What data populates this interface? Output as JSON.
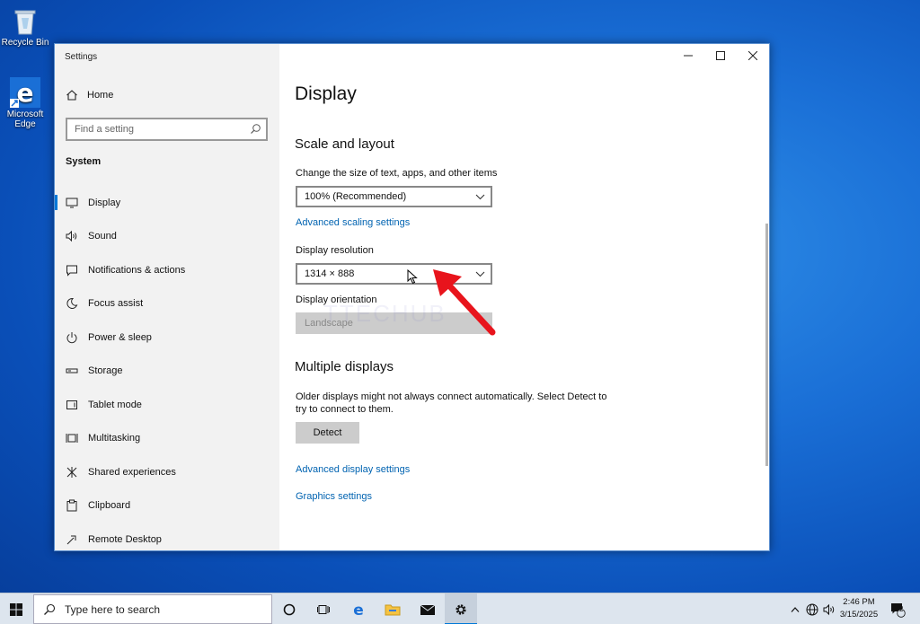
{
  "desktop": {
    "icons": [
      {
        "label": "Recycle Bin",
        "icon": "recycle-bin-icon"
      },
      {
        "label": "Microsoft Edge",
        "icon": "edge-icon"
      }
    ]
  },
  "window": {
    "title": "Settings",
    "controls": [
      "minimize-icon",
      "maximize-icon",
      "close-icon"
    ]
  },
  "sidebar": {
    "home_label": "Home",
    "search_placeholder": "Find a setting",
    "section_label": "System",
    "items": [
      {
        "label": "Display",
        "icon": "monitor-icon",
        "active": true
      },
      {
        "label": "Sound",
        "icon": "speaker-icon"
      },
      {
        "label": "Notifications & actions",
        "icon": "notification-icon"
      },
      {
        "label": "Focus assist",
        "icon": "moon-icon"
      },
      {
        "label": "Power & sleep",
        "icon": "power-icon"
      },
      {
        "label": "Storage",
        "icon": "storage-icon"
      },
      {
        "label": "Tablet mode",
        "icon": "tablet-icon"
      },
      {
        "label": "Multitasking",
        "icon": "multitasking-icon"
      },
      {
        "label": "Shared experiences",
        "icon": "shared-icon"
      },
      {
        "label": "Clipboard",
        "icon": "clipboard-icon"
      },
      {
        "label": "Remote Desktop",
        "icon": "remote-icon"
      }
    ]
  },
  "main": {
    "page_title": "Display",
    "scale_heading": "Scale and layout",
    "scale_label": "Change the size of text, apps, and other items",
    "scale_value": "100% (Recommended)",
    "advanced_scaling_link": "Advanced scaling settings",
    "resolution_label": "Display resolution",
    "resolution_value": "1314 × 888",
    "orientation_label": "Display orientation",
    "orientation_value": "Landscape",
    "multiple_heading": "Multiple displays",
    "multiple_text": "Older displays might not always connect automatically. Select Detect to try to connect to them.",
    "detect_button": "Detect",
    "advanced_display_link": "Advanced display settings",
    "graphics_link": "Graphics settings",
    "watermark": "TTECHUB"
  },
  "taskbar": {
    "search_placeholder": "Type here to search",
    "time": "2:46 PM",
    "date": "3/15/2025",
    "notification_count": "2"
  },
  "colors": {
    "accent": "#0078d7",
    "link": "#0063b1",
    "arrow": "#e8141c"
  }
}
